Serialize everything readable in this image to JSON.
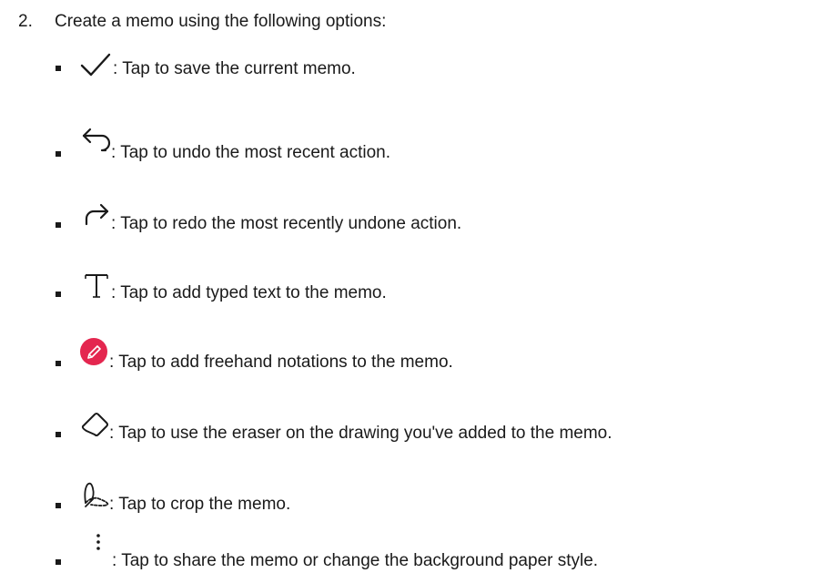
{
  "step": {
    "number": "2.",
    "text": "Create a memo using the following options:"
  },
  "options": [
    {
      "icon": "checkmark-icon",
      "text": ": Tap to save the current memo."
    },
    {
      "icon": "undo-icon",
      "text": ": Tap to undo the most recent action."
    },
    {
      "icon": "redo-icon",
      "text": ": Tap to redo the most recently undone action."
    },
    {
      "icon": "text-icon",
      "text": ": Tap to add typed text to the memo."
    },
    {
      "icon": "pen-icon",
      "text": ": Tap to add freehand notations to the memo."
    },
    {
      "icon": "eraser-icon",
      "text": ": Tap to use the eraser on the drawing you've added to the memo."
    },
    {
      "icon": "crop-icon",
      "text": ": Tap to crop the memo."
    },
    {
      "icon": "more-options-icon",
      "text": ": Tap to share the memo or change the background paper style."
    }
  ],
  "colors": {
    "text": "#1a1a1a",
    "pen_icon_fill": "#e4264f"
  }
}
